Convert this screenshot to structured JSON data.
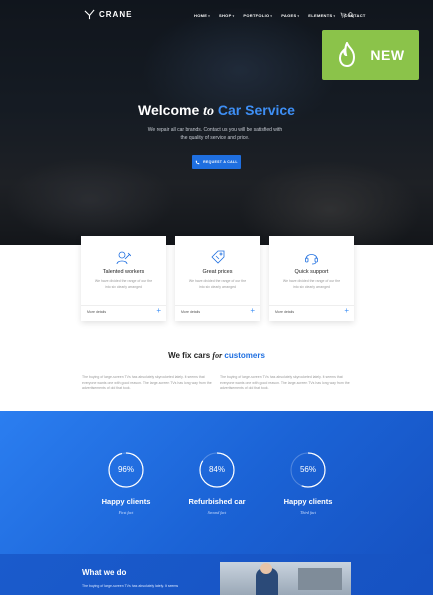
{
  "brand": {
    "name": "CRANE"
  },
  "nav": [
    {
      "label": "HOME",
      "caret": "▾"
    },
    {
      "label": "SHOP",
      "caret": "▾"
    },
    {
      "label": "PORTFOLIO",
      "caret": "▾"
    },
    {
      "label": "PAGES",
      "caret": "▾"
    },
    {
      "label": "ELEMENTS",
      "caret": "▾"
    },
    {
      "label": "CONTACT",
      "caret": ""
    }
  ],
  "badge": {
    "label": "NEW",
    "color": "#8bc34a"
  },
  "hero": {
    "title_a": "Welcome ",
    "title_to": "to",
    "title_b": " Car Service",
    "subtitle": "We repair all car brands. Contact us you will be satisfied with the quality of service and price.",
    "button": "REQUEST A CALL"
  },
  "cards": [
    {
      "icon": "worker-icon",
      "title": "Talented workers",
      "text": "We have divided the range of our the into six clearly arranged",
      "more": "More details",
      "plus": "+"
    },
    {
      "icon": "price-tag-icon",
      "title": "Great prices",
      "text": "We have divided the range of our the into six clearly arranged",
      "more": "More details",
      "plus": "+"
    },
    {
      "icon": "headset-icon",
      "title": "Quick support",
      "text": "We have divided the range of our the into six clearly arranged",
      "more": "More details",
      "plus": "+"
    }
  ],
  "fix": {
    "title_a": "We fix cars ",
    "title_for": "for",
    "title_b": " customers",
    "left": "The buying of large-screen TVs has absolutely skyrocketed lately. It seems that everyone wants one with good reason. The large-screen TVs has long way from the advertisements of old that took.",
    "right": "The buying of large-screen TVs has absolutely skyrocketed lately. It seems that everyone wants one with good reason. The large-screen TVs has long way from the advertisements of old that took."
  },
  "stats": [
    {
      "value": "96%",
      "percent": 96,
      "label": "Happy clients",
      "sub": "First fact"
    },
    {
      "value": "84%",
      "percent": 84,
      "label": "Refurbished car",
      "sub": "Second fact"
    },
    {
      "value": "56%",
      "percent": 56,
      "label": "Happy clients",
      "sub": "Third fact"
    }
  ],
  "what_we_do": {
    "title": "What we do",
    "text": "The buying of large-screen TVs has absolutely lately. It seems"
  },
  "colors": {
    "accent": "#3e8ff5",
    "primary": "#1f6fe0",
    "stats_bg": "#1b63d6"
  }
}
